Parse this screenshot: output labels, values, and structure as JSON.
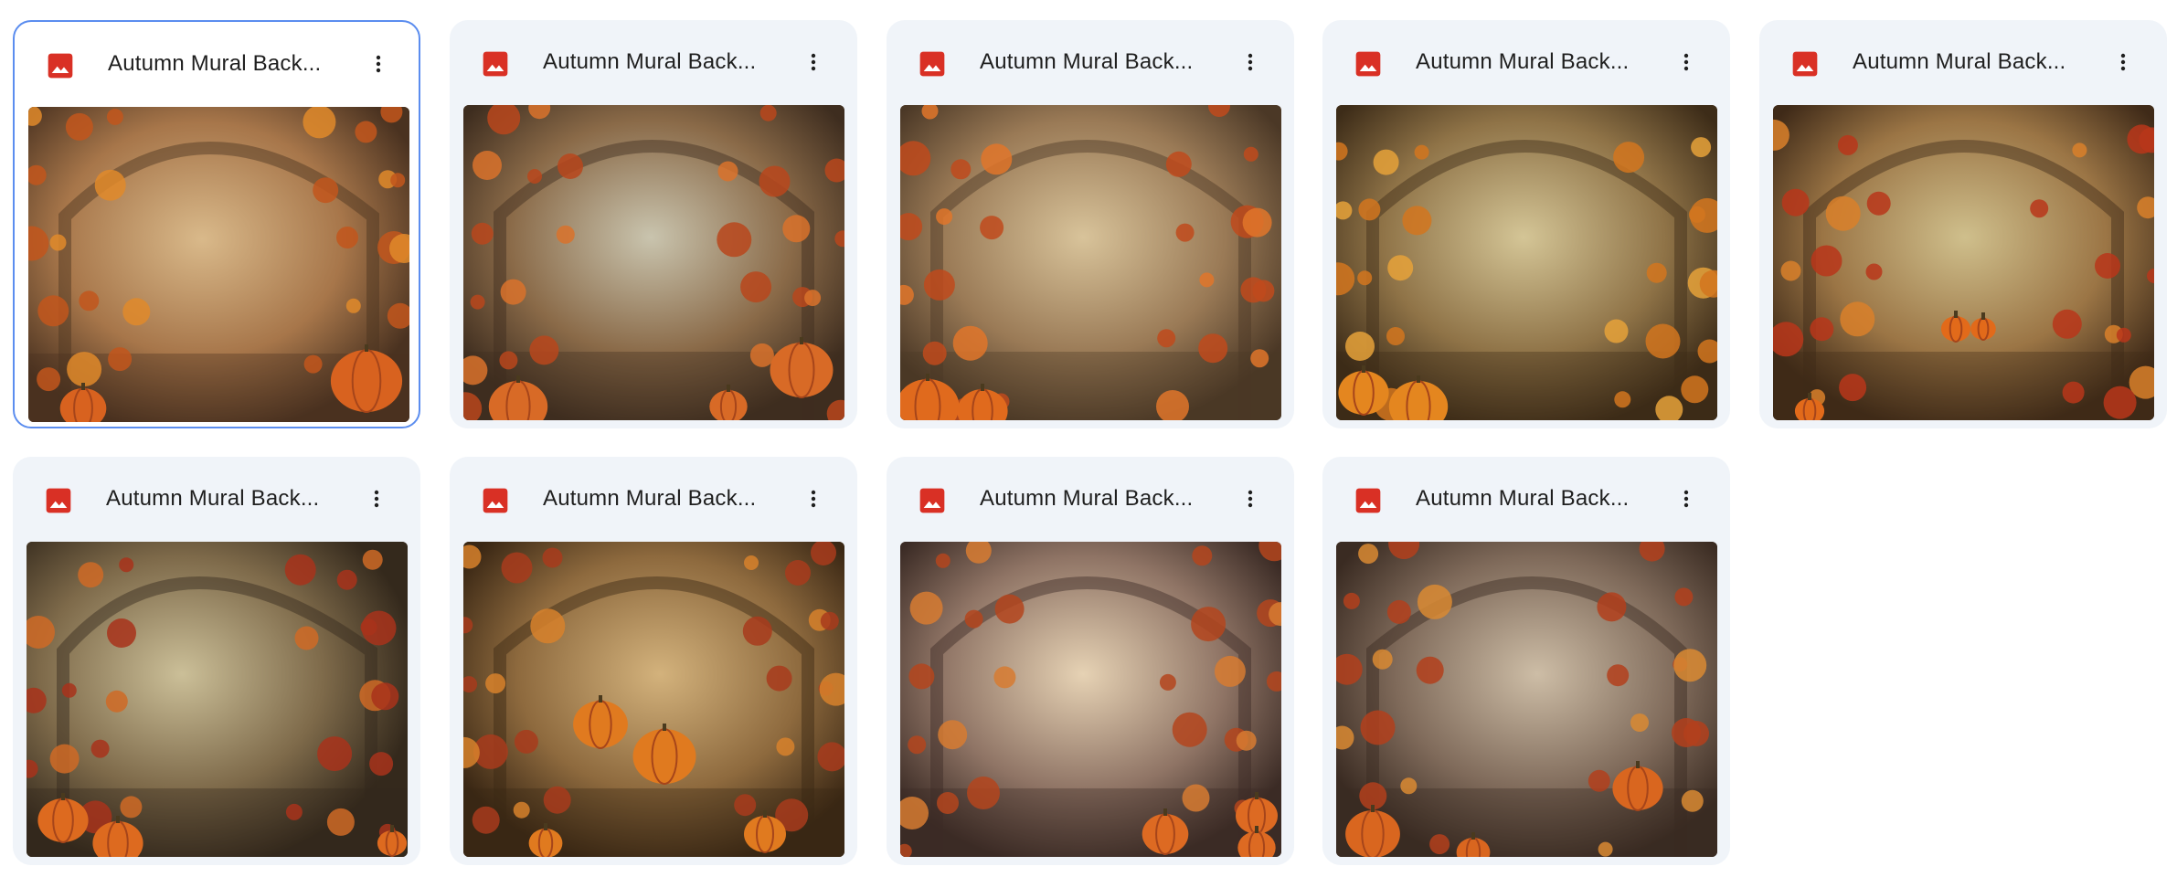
{
  "files": [
    {
      "name": "Autumn Mural Back...",
      "type_icon": "image-file-icon",
      "more_icon": "more-vert-icon",
      "selected": true,
      "variant": 0
    },
    {
      "name": "Autumn Mural Back...",
      "type_icon": "image-file-icon",
      "more_icon": "more-vert-icon",
      "selected": false,
      "variant": 1
    },
    {
      "name": "Autumn Mural Back...",
      "type_icon": "image-file-icon",
      "more_icon": "more-vert-icon",
      "selected": false,
      "variant": 2
    },
    {
      "name": "Autumn Mural Back...",
      "type_icon": "image-file-icon",
      "more_icon": "more-vert-icon",
      "selected": false,
      "variant": 3
    },
    {
      "name": "Autumn Mural Back...",
      "type_icon": "image-file-icon",
      "more_icon": "more-vert-icon",
      "selected": false,
      "variant": 4
    },
    {
      "name": "Autumn Mural Back...",
      "type_icon": "image-file-icon",
      "more_icon": "more-vert-icon",
      "selected": false,
      "variant": 5
    },
    {
      "name": "Autumn Mural Back...",
      "type_icon": "image-file-icon",
      "more_icon": "more-vert-icon",
      "selected": false,
      "variant": 6
    },
    {
      "name": "Autumn Mural Back...",
      "type_icon": "image-file-icon",
      "more_icon": "more-vert-icon",
      "selected": false,
      "variant": 7
    },
    {
      "name": "Autumn Mural Back...",
      "type_icon": "image-file-icon",
      "more_icon": "more-vert-icon",
      "selected": false,
      "variant": 8
    }
  ],
  "colors": {
    "card_bg": "#f0f4f9",
    "selected_border": "#5b8def",
    "image_icon_red": "#d93025",
    "text": "#1f1f1f"
  }
}
